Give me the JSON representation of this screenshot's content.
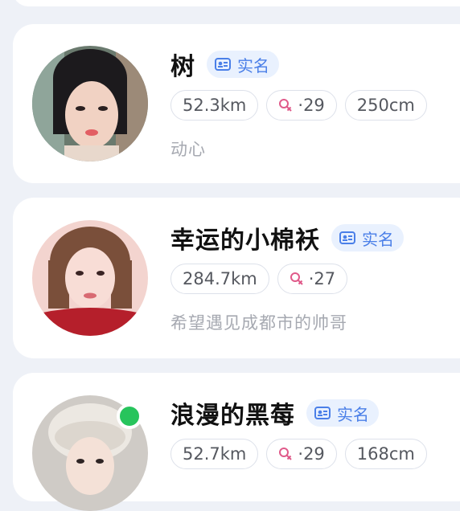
{
  "colors": {
    "background": "#eef1f7",
    "card": "#ffffff",
    "verified_badge_bg": "#e9f1fe",
    "verified_badge_text": "#4a7fe8",
    "female_icon": "#e05a8a",
    "online": "#27c45c",
    "bio_text": "#a6a9b1"
  },
  "users": [
    {
      "name": "树",
      "verified_label": "实名",
      "distance": "52.3km",
      "age": "·29",
      "height": "250cm",
      "bio": "动心",
      "online": false
    },
    {
      "name": "幸运的小棉袄",
      "verified_label": "实名",
      "distance": "284.7km",
      "age": "·27",
      "bio": "希望遇见成都市的帅哥",
      "online": false
    },
    {
      "name": "浪漫的黑莓",
      "verified_label": "实名",
      "distance": "52.7km",
      "age": "·29",
      "height": "168cm",
      "online": true
    }
  ]
}
